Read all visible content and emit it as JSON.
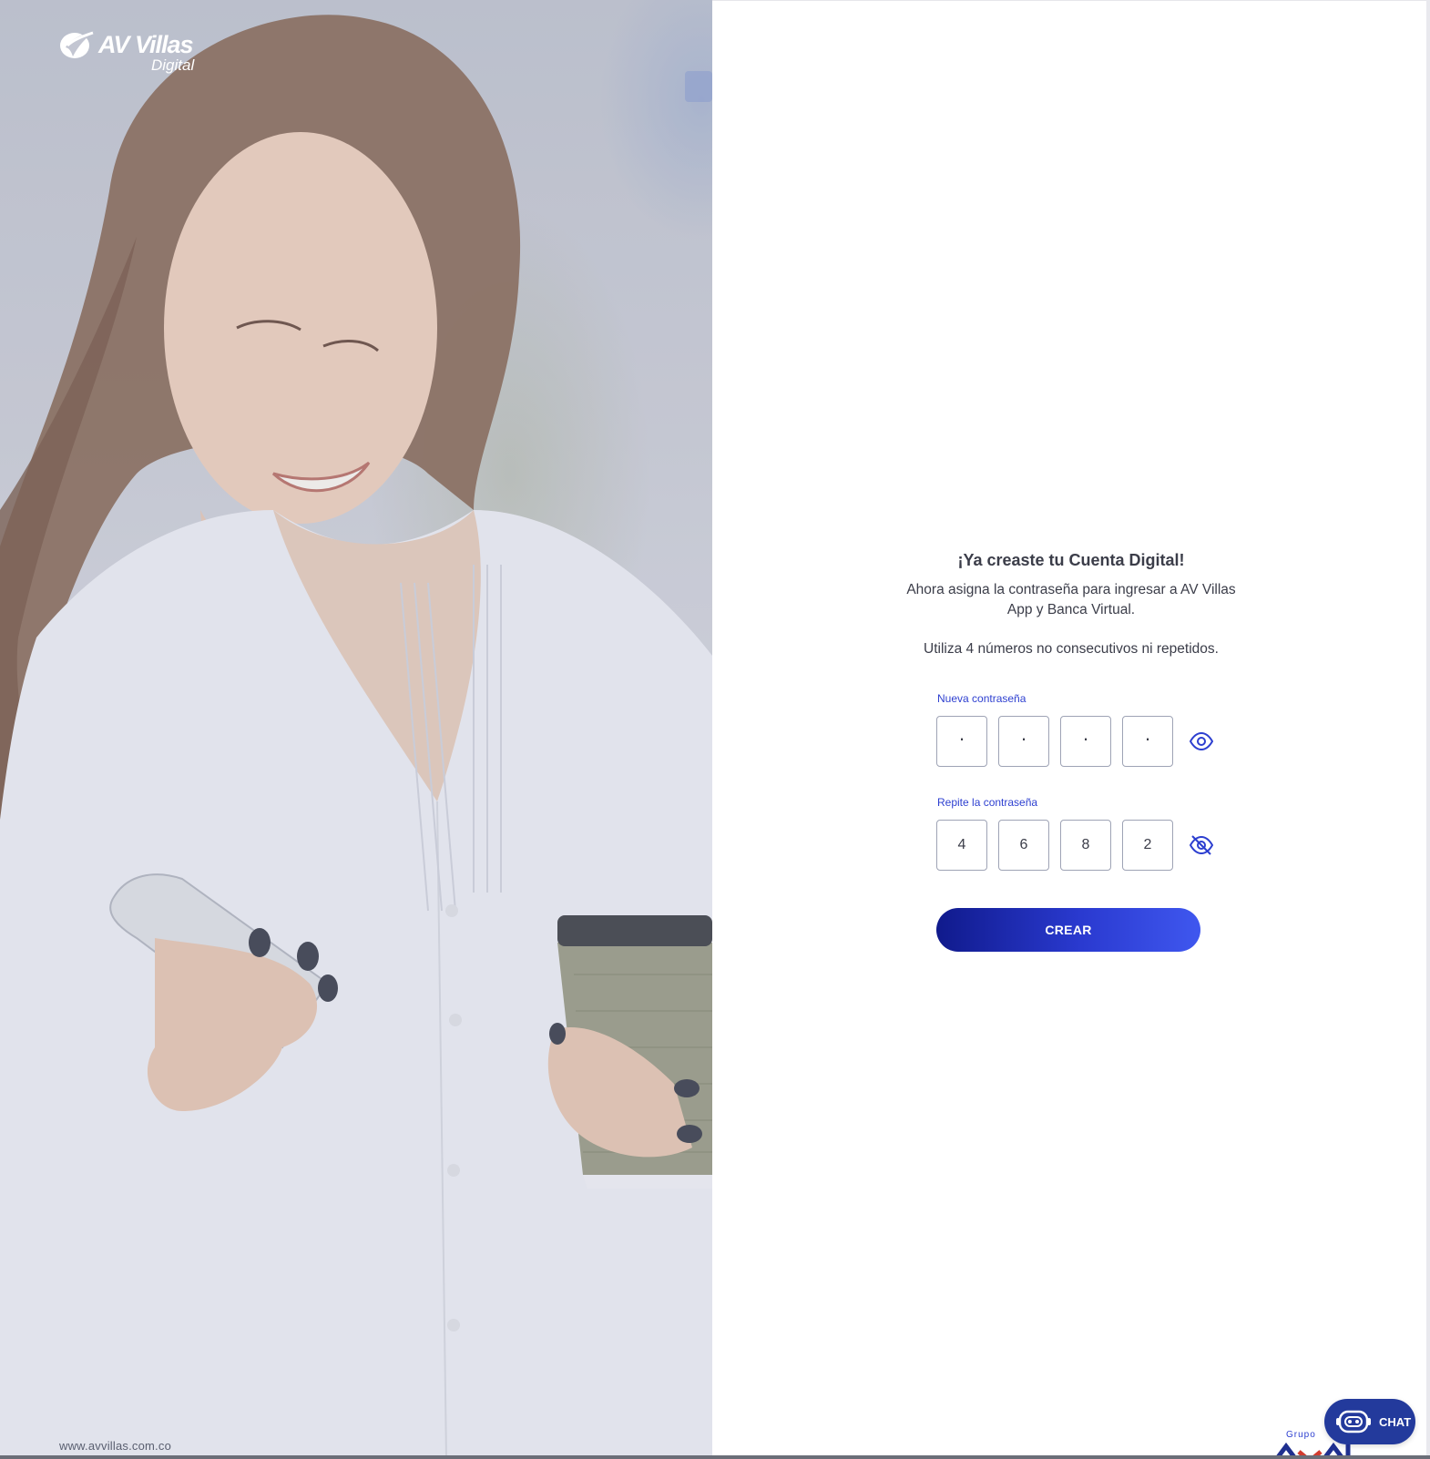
{
  "brand": {
    "name": "AV Villas",
    "sub": "Digital",
    "website": "www.avvillas.com.co"
  },
  "form": {
    "title": "¡Ya creaste tu Cuenta Digital!",
    "subtitle": "Ahora asigna la contraseña para ingresar a AV Villas App y Banca Virtual.",
    "hint": "Utiliza 4 números no consecutivos ni repetidos.",
    "new_password": {
      "label": "Nueva contraseña",
      "digits": [
        "·",
        "·",
        "·",
        "·"
      ],
      "visibility_icon": "eye-icon"
    },
    "repeat_password": {
      "label": "Repite la contraseña",
      "digits": [
        "4",
        "6",
        "8",
        "2"
      ],
      "visibility_icon": "eye-off-icon"
    },
    "submit_label": "CREAR"
  },
  "chat": {
    "label": "CHAT",
    "icon": "robot-icon"
  },
  "footer": {
    "group_small": "Grupo",
    "group_big": "AVAL"
  },
  "colors": {
    "accent": "#2d3fd0",
    "button_start": "#101a8c",
    "button_end": "#3f57ef",
    "chat_bg": "#233a9c",
    "text": "#3b3d49"
  }
}
